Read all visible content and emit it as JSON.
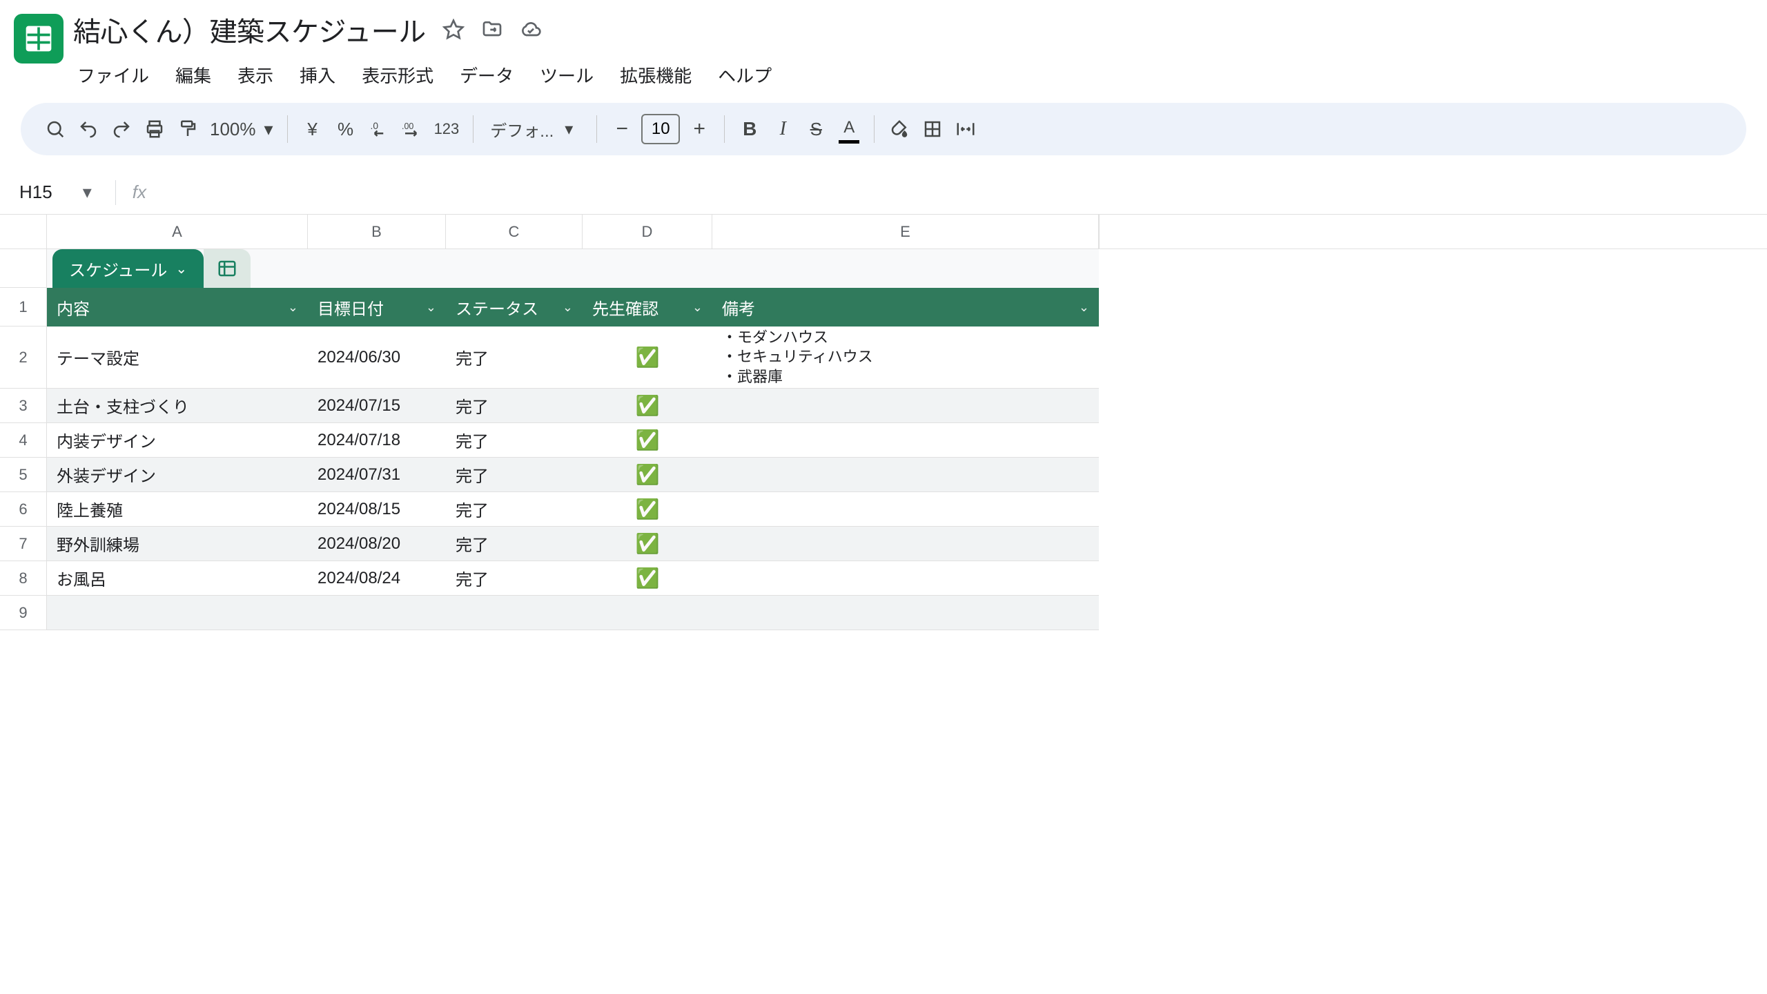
{
  "doc": {
    "title": "結心くん）建築スケジュール"
  },
  "menu": {
    "file": "ファイル",
    "edit": "編集",
    "view": "表示",
    "insert": "挿入",
    "format": "表示形式",
    "data": "データ",
    "tools": "ツール",
    "extensions": "拡張機能",
    "help": "ヘルプ"
  },
  "toolbar": {
    "zoom": "100%",
    "currency": "¥",
    "percent": "%",
    "decDec": ".0",
    "incDec": ".00",
    "numfmt": "123",
    "font": "デフォ...",
    "fontsize": "10"
  },
  "namebox": {
    "cell": "H15"
  },
  "tab": {
    "name": "スケジュール"
  },
  "columns": {
    "a": "A",
    "b": "B",
    "c": "C",
    "d": "D",
    "e": "E"
  },
  "headers": {
    "content": "内容",
    "date": "目標日付",
    "status": "ステータス",
    "confirm": "先生確認",
    "note": "備考"
  },
  "rows": [
    {
      "n": "2",
      "content": "テーマ設定",
      "date": "2024/06/30",
      "status": "完了",
      "confirm": "✅",
      "note": "・モダンハウス\n・セキュリティハウス\n・武器庫",
      "tall": true
    },
    {
      "n": "3",
      "content": "土台・支柱づくり",
      "date": "2024/07/15",
      "status": "完了",
      "confirm": "✅",
      "note": "",
      "alt": true
    },
    {
      "n": "4",
      "content": "内装デザイン",
      "date": "2024/07/18",
      "status": "完了",
      "confirm": "✅",
      "note": ""
    },
    {
      "n": "5",
      "content": "外装デザイン",
      "date": "2024/07/31",
      "status": "完了",
      "confirm": "✅",
      "note": "",
      "alt": true
    },
    {
      "n": "6",
      "content": "陸上養殖",
      "date": "2024/08/15",
      "status": "完了",
      "confirm": "✅",
      "note": ""
    },
    {
      "n": "7",
      "content": "野外訓練場",
      "date": "2024/08/20",
      "status": "完了",
      "confirm": "✅",
      "note": "",
      "alt": true
    },
    {
      "n": "8",
      "content": "お風呂",
      "date": "2024/08/24",
      "status": "完了",
      "confirm": "✅",
      "note": ""
    },
    {
      "n": "9",
      "content": "",
      "date": "",
      "status": "",
      "confirm": "",
      "note": "",
      "empty": true,
      "alt": true
    }
  ]
}
